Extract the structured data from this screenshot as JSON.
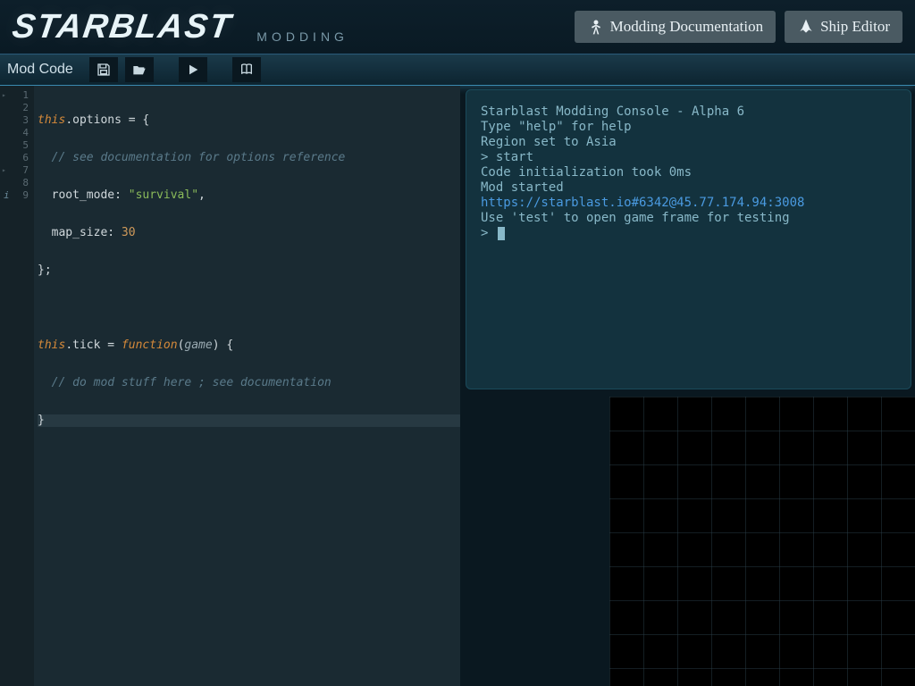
{
  "header": {
    "logo": "STARBLAST",
    "sub": "MODDING",
    "doc_btn": "Modding Documentation",
    "ship_btn": "Ship Editor"
  },
  "toolbar": {
    "label": "Mod Code"
  },
  "editor": {
    "lines": [
      {
        "n": "1",
        "dash": true
      },
      {
        "n": "2"
      },
      {
        "n": "3"
      },
      {
        "n": "4"
      },
      {
        "n": "5"
      },
      {
        "n": "6"
      },
      {
        "n": "7",
        "dash": true
      },
      {
        "n": "8"
      },
      {
        "n": "9",
        "info": true
      }
    ],
    "code": {
      "l1_this": "this",
      "l1_rest": ".options = {",
      "l2": "  // see documentation for options reference",
      "l3_key": "  root_mode: ",
      "l3_str": "\"survival\"",
      "l3_end": ",",
      "l4_key": "  map_size: ",
      "l4_num": "30",
      "l5": "};",
      "l7_this": "this",
      "l7_a": ".tick = ",
      "l7_func": "function",
      "l7_b": "(",
      "l7_param": "game",
      "l7_c": ") {",
      "l8": "  // do mod stuff here ; see documentation",
      "l9": "}"
    }
  },
  "console": {
    "l1": "Starblast Modding Console - Alpha 6",
    "l2": "Type \"help\" for help",
    "l3": "Region set to Asia",
    "l4": "> start",
    "l5": "Code initialization took 0ms",
    "l6": "Mod started",
    "l7": "https://starblast.io#6342@45.77.174.94:3008",
    "l8": "Use 'test' to open game frame for testing",
    "l9": "> "
  }
}
